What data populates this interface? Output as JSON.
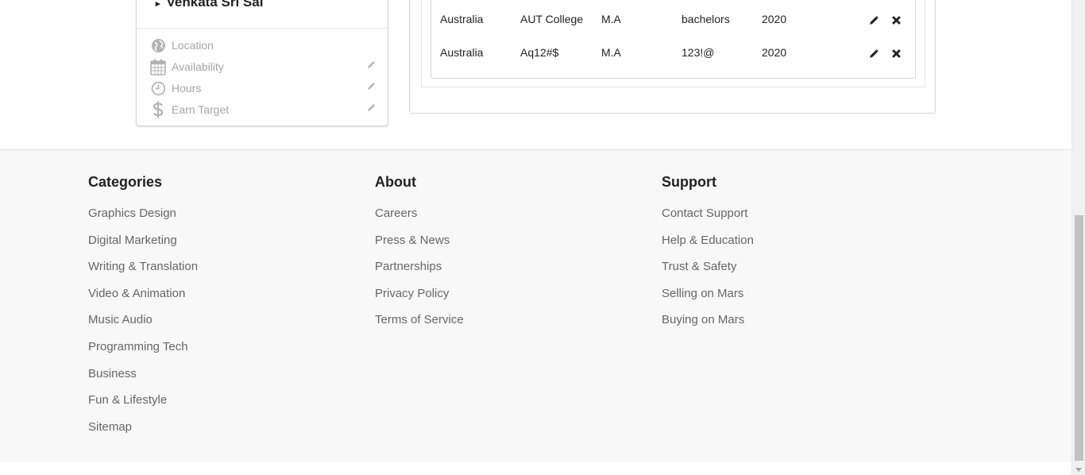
{
  "profile": {
    "name": "Venkata Sri Sai",
    "caret": "▸",
    "rows": [
      {
        "label": "Location",
        "icon": "globe-icon",
        "editable": false
      },
      {
        "label": "Availability",
        "icon": "calendar-icon",
        "editable": true
      },
      {
        "label": "Hours",
        "icon": "clock-icon",
        "editable": true
      },
      {
        "label": "Earn Target",
        "icon": "dollar-icon",
        "editable": true
      }
    ]
  },
  "education": {
    "rows": [
      {
        "country": "Australia",
        "college": "AUT College",
        "title": "M.A",
        "degree": "bachelors",
        "year": "2020"
      },
      {
        "country": "Australia",
        "college": "Aq12#$",
        "title": "M.A",
        "degree": "123!@",
        "year": "2020"
      }
    ]
  },
  "footer": {
    "categories": {
      "title": "Categories",
      "items": [
        "Graphics Design",
        "Digital Marketing",
        "Writing & Translation",
        "Video & Animation",
        "Music Audio",
        "Programming Tech",
        "Business",
        "Fun & Lifestyle",
        "Sitemap"
      ]
    },
    "about": {
      "title": "About",
      "items": [
        "Careers",
        "Press & News",
        "Partnerships",
        "Privacy Policy",
        "Terms of Service"
      ]
    },
    "support": {
      "title": "Support",
      "items": [
        "Contact Support",
        "Help & Education",
        "Trust & Safety",
        "Selling on Mars",
        "Buying on Mars"
      ]
    }
  },
  "colors": {
    "footer_bg": "#f8f8f8",
    "muted_text": "#a5a5a5",
    "link_text": "#666666"
  }
}
